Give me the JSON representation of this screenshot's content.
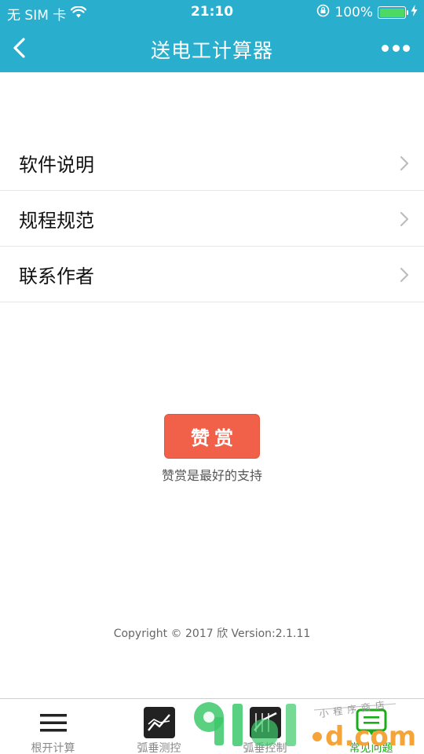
{
  "status_bar": {
    "carrier": "无 SIM 卡",
    "time": "21:10",
    "battery_percent": "100%",
    "battery_level": 1.0
  },
  "nav": {
    "title": "送电工计算器",
    "back_icon": "chevron-left-icon",
    "more_icon": "more-dots-icon"
  },
  "menu": {
    "items": [
      {
        "label": "软件说明"
      },
      {
        "label": "规程规范"
      },
      {
        "label": "联系作者"
      }
    ]
  },
  "reward": {
    "button_label": "赞赏",
    "caption": "赞赏是最好的支持"
  },
  "footer": {
    "copyright": "Copyright © 2017 欣 Version:2.1.11"
  },
  "tabbar": {
    "tabs": [
      {
        "label": "根开计算",
        "icon": "menu-icon",
        "active": false
      },
      {
        "label": "弧垂测控",
        "icon": "chart-line-icon",
        "active": false
      },
      {
        "label": "弧垂控制",
        "icon": "chart-grid-icon",
        "active": false
      },
      {
        "label": "常见问题",
        "icon": "question-list-icon",
        "active": true
      }
    ]
  },
  "watermark": {
    "brand": "91",
    "domain": "d.com",
    "tagline": "小程序商店"
  },
  "colors": {
    "header": "#2aaecd",
    "reward_button": "#f16048",
    "tab_active": "#1aad19",
    "watermark_green": "#3cc96a",
    "watermark_orange": "#f5a43a"
  }
}
